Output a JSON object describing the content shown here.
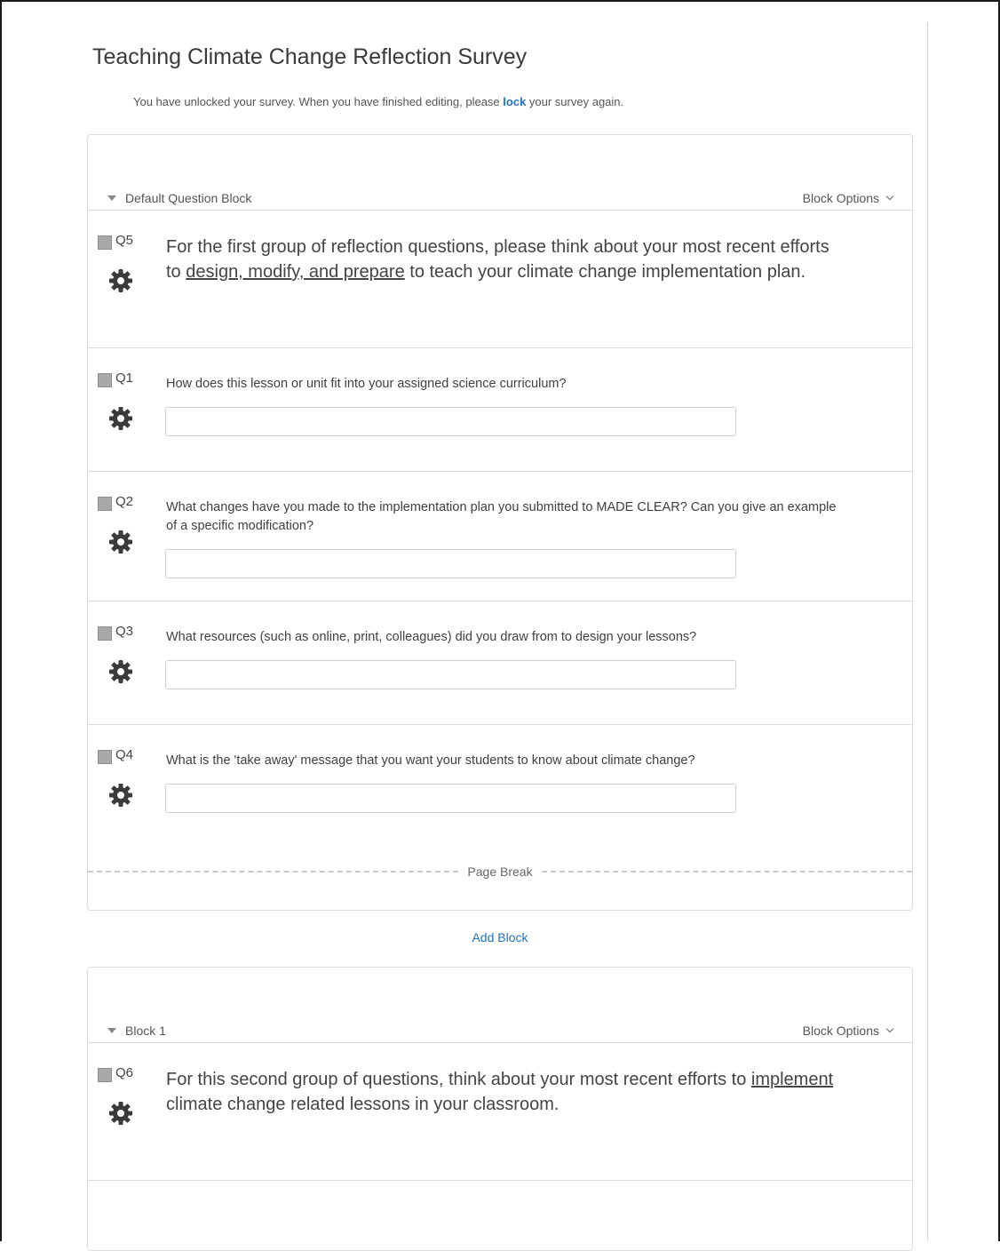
{
  "survey": {
    "title": "Teaching Climate Change Reflection Survey",
    "notice_before": "You have unlocked your survey. When you have finished editing, please ",
    "notice_link": "lock",
    "notice_after": " your survey again."
  },
  "blocks": [
    {
      "name": "Default Question Block",
      "options_label": "Block Options",
      "questions": [
        {
          "number": "Q5",
          "text_parts": [
            "For the first group of reflection questions, please think about your most recent efforts to ",
            "design, modify, and prepare",
            " to teach your climate change implementation plan."
          ]
        },
        {
          "number": "Q1",
          "text": "How does this lesson or unit fit into your assigned science curriculum?",
          "value": ""
        },
        {
          "number": "Q2",
          "text": "What changes have you made to the implementation plan you submitted to MADE CLEAR?  Can you give an example of a specific modification?",
          "value": ""
        },
        {
          "number": "Q3",
          "text": "What resources (such as online, print, colleagues) did you draw from to design your lessons?",
          "value": ""
        },
        {
          "number": "Q4",
          "text": "What is the 'take away' message that you want your students to know about climate change?",
          "value": ""
        }
      ],
      "page_break_label": "Page Break"
    },
    {
      "name": "Block 1",
      "options_label": "Block Options",
      "questions": [
        {
          "number": "Q6",
          "text_parts": [
            "For this second group of questions, think about your most recent efforts to ",
            "implement ",
            "climate change related lessons in your classroom."
          ]
        }
      ]
    }
  ],
  "add_block_label": "Add Block",
  "colors": {
    "link": "#1e73be",
    "border": "#dcdcdc",
    "checkbox": "#a8a8a8",
    "text": "#404040"
  },
  "icons": {
    "block_toggle": "caret-down-icon",
    "block_options": "chevron-down-icon",
    "question_settings": "gear-icon",
    "text_entry_resize": "resize-grip-icon"
  }
}
